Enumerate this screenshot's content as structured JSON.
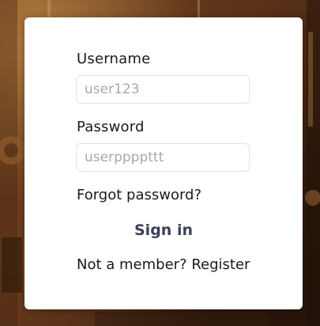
{
  "login_form": {
    "username_label": "Username",
    "username_placeholder": "user123",
    "password_label": "Password",
    "password_placeholder": "userppppttt",
    "forgot_password": "Forgot password?",
    "sign_in": "Sign in",
    "register_text": "Not a member? Register"
  },
  "colors": {
    "card_background": "#ffffff",
    "sign_in_text": "#3b3f57",
    "input_border": "#e2e2e2",
    "placeholder": "#a9a9a9"
  }
}
